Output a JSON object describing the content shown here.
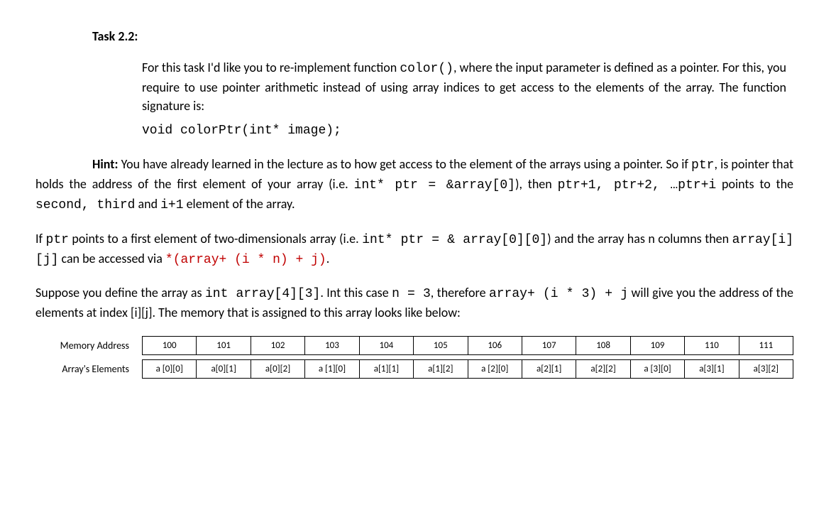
{
  "task_title": "Task 2.2:",
  "intro": {
    "t1": "For this task I'd like you to re-implement function ",
    "c1": "color()",
    "t2": ", where the input parameter is defined as a pointer. For this, you require to use pointer arithmetic instead of using array indices to get access to the elements of the array. The function signature is:"
  },
  "signature": "void colorPtr(int* image);",
  "hint": {
    "lead": "Hint:",
    "t1": " You have already learned in the lecture as to how get access to the element of the arrays using a pointer. So if ",
    "c1": "ptr",
    "t2": ", is pointer that holds the address of the first element of your array (i.e. ",
    "c2": "int* ptr = &array[0]",
    "t3": "), then ",
    "c3": "ptr+1, ptr+2, …ptr+i",
    "t4": " points to the ",
    "c4": "second, third",
    "t5": " and ",
    "c5": "i+1",
    "t6": " element of the array."
  },
  "p2": {
    "t1": "If ",
    "c1": "ptr",
    "t2": " points to a first element of two-dimensionals array (i.e. ",
    "c2": "int* ptr = & array[0][0]",
    "t3": ") and the array has n columns then ",
    "c3": "array[i][j]",
    "t4": " can be accessed via ",
    "r1": "*(array+ (i * n) + j)",
    "t5": "."
  },
  "p3": {
    "t1": "Suppose you define the array as ",
    "c1": "int array[4][3]",
    "t2": ". Int this case ",
    "c2": "n = 3",
    "t3": ", therefore ",
    "c3": "array+ (i * 3) + j",
    "t4": " will give you the address of the elements at index [i][j]. The memory that is assigned to this array looks like below:"
  },
  "table": {
    "row1_label": "Memory Address",
    "row2_label": "Array's Elements",
    "addresses": [
      "100",
      "101",
      "102",
      "103",
      "104",
      "105",
      "106",
      "107",
      "108",
      "109",
      "110",
      "111"
    ],
    "elements": [
      "a [0][0]",
      "a[0][1]",
      "a[0][2]",
      "a [1][0]",
      "a[1][1]",
      "a[1][2]",
      "a [2][0]",
      "a[2][1]",
      "a[2][2]",
      "a [3][0]",
      "a[3][1]",
      "a[3][2]"
    ]
  }
}
